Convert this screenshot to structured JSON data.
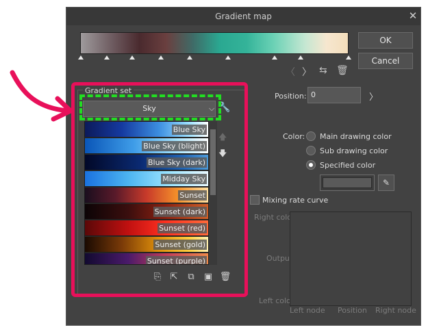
{
  "dialog": {
    "title": "Gradient map",
    "close_icon": "close-icon",
    "ok_label": "OK",
    "cancel_label": "Cancel"
  },
  "toolbar_icons": [
    "chevron-left-icon",
    "chevron-right-icon",
    "flip-icon",
    "trash-icon"
  ],
  "gradient_set": {
    "group_label": "Gradient set",
    "selected": "Sky",
    "items": [
      {
        "label": "Blue Sky"
      },
      {
        "label": "Blue Sky (blight)"
      },
      {
        "label": "Blue Sky (dark)"
      },
      {
        "label": "Midday Sky"
      },
      {
        "label": "Sunset"
      },
      {
        "label": "Sunset (dark)"
      },
      {
        "label": "Sunset (red)"
      },
      {
        "label": "Sunset (gold)"
      },
      {
        "label": "Sunset (purple)"
      }
    ],
    "bottom_icons": [
      "import-icon",
      "export-icon",
      "duplicate-icon",
      "add-gradient-icon",
      "delete-icon"
    ]
  },
  "position": {
    "label": "Position:",
    "value": "0"
  },
  "color": {
    "label": "Color:",
    "options": [
      {
        "label": "Main drawing color",
        "selected": false
      },
      {
        "label": "Sub drawing color",
        "selected": false
      },
      {
        "label": "Specified color",
        "selected": true
      }
    ]
  },
  "mixing": {
    "label": "Mixing rate curve",
    "right_color": "Right color",
    "output": "Output",
    "left_color": "Left color",
    "left_node": "Left node",
    "position": "Position",
    "right_node": "Right node"
  },
  "annotation_colors": {
    "highlight_frame": "#e8105a",
    "dashed_frame": "#22dd22",
    "arrow": "#e8105a"
  }
}
